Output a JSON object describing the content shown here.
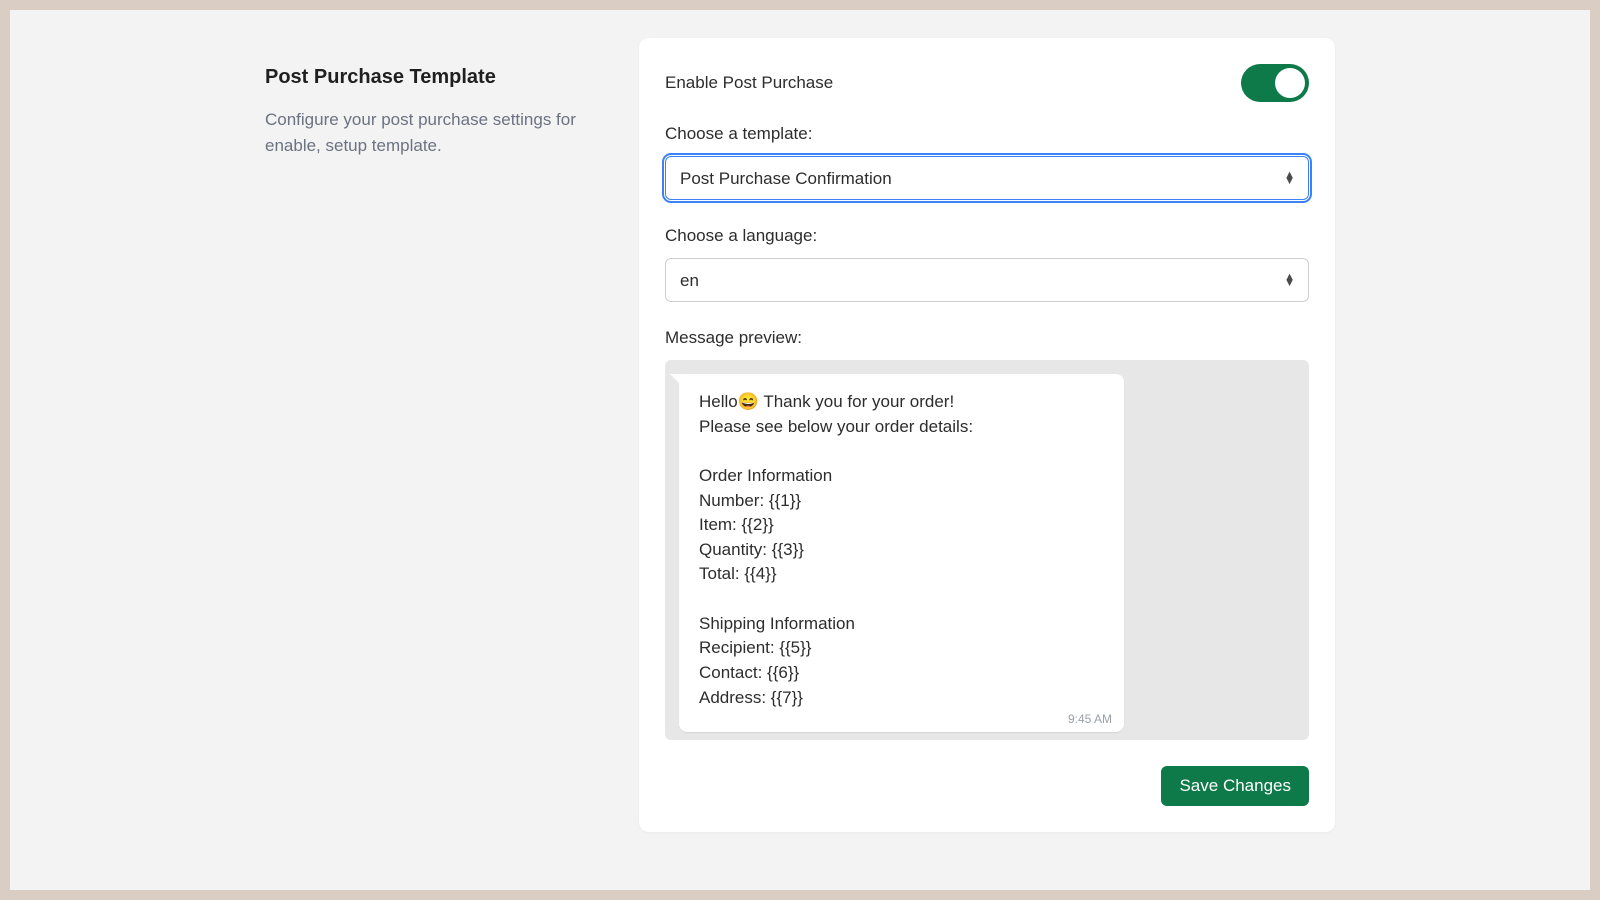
{
  "left": {
    "title": "Post Purchase Template",
    "description": "Configure your post purchase settings for enable, setup template."
  },
  "form": {
    "enable_label": "Enable Post Purchase",
    "enabled": true,
    "template_label": "Choose a template:",
    "template_selected": "Post Purchase Confirmation",
    "language_label": "Choose a language:",
    "language_selected": "en",
    "preview_label": "Message preview:",
    "save_label": "Save Changes"
  },
  "preview": {
    "message": "Hello😄 Thank you for your order!\nPlease see below your order details:\n\nOrder Information\nNumber: {{1}}\nItem: {{2}}\nQuantity: {{3}}\nTotal: {{4}}\n\nShipping Information\nRecipient: {{5}}\nContact: {{6}}\nAddress: {{7}}",
    "timestamp": "9:45 AM"
  }
}
